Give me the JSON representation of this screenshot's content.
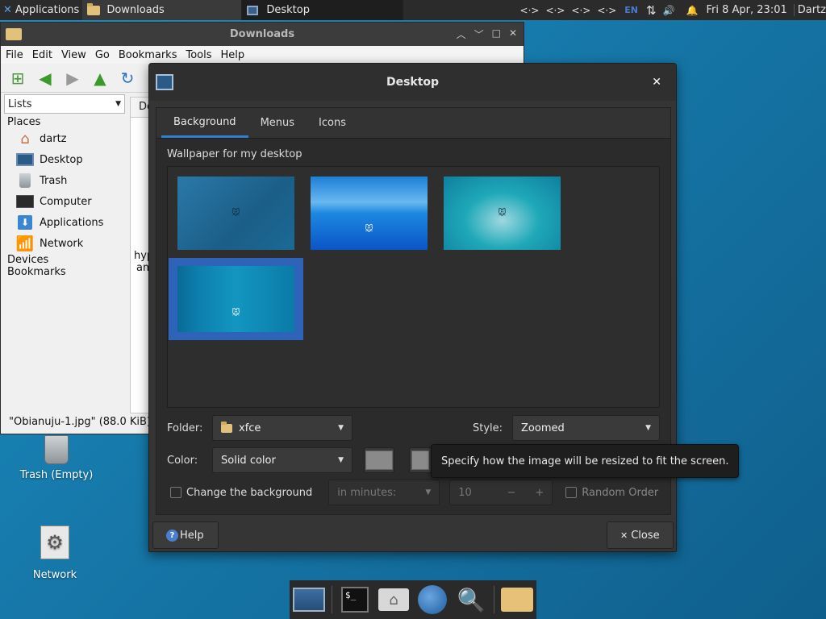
{
  "top_panel": {
    "apps_label": "Applications",
    "tasks": [
      {
        "label": "Downloads"
      },
      {
        "label": "Desktop"
      }
    ],
    "tray": {
      "net_icons": [
        "<·>",
        "<·>",
        "<·>",
        "<·>"
      ],
      "lang": "EN",
      "clock": "Fri  8 Apr, 23:01",
      "user": "Dartz"
    }
  },
  "file_manager": {
    "title": "Downloads",
    "menu": [
      "File",
      "Edit",
      "View",
      "Go",
      "Bookmarks",
      "Tools",
      "Help"
    ],
    "side_mode": "Lists",
    "places_heading": "Places",
    "places": [
      {
        "label": "dartz",
        "icon": "home-icon"
      },
      {
        "label": "Desktop",
        "icon": "desktop-icon"
      },
      {
        "label": "Trash",
        "icon": "trash-icon"
      },
      {
        "label": "Computer",
        "icon": "computer-icon"
      },
      {
        "label": "Applications",
        "icon": "applications-icon"
      },
      {
        "label": "Network",
        "icon": "network-icon"
      }
    ],
    "devices_heading": "Devices",
    "bookmarks_heading": "Bookmarks",
    "tab_stub": "Do",
    "clip_1": "hyp",
    "clip_2": "am",
    "status": "\"Obianuju-1.jpg\" (88.0 KiB)"
  },
  "desktop_icons": {
    "trash_label": "Trash (Empty)",
    "network_label": "Network"
  },
  "dialog": {
    "title": "Desktop",
    "tabs": [
      "Background",
      "Menus",
      "Icons"
    ],
    "active_tab": "Background",
    "wallpaper_label": "Wallpaper for my desktop",
    "folder_label": "Folder:",
    "folder_value": "xfce",
    "style_label": "Style:",
    "style_value": "Zoomed",
    "color_label": "Color:",
    "color_value": "Solid color",
    "change_bg_label": "Change the background",
    "interval_value": "in minutes:",
    "minutes_value": "10",
    "random_label": "Random Order",
    "help_label": "Help",
    "close_label": "Close",
    "swatch_color": "#8a8a8a"
  },
  "tooltip": {
    "text": "Specify how the image will be resized to fit the screen."
  }
}
